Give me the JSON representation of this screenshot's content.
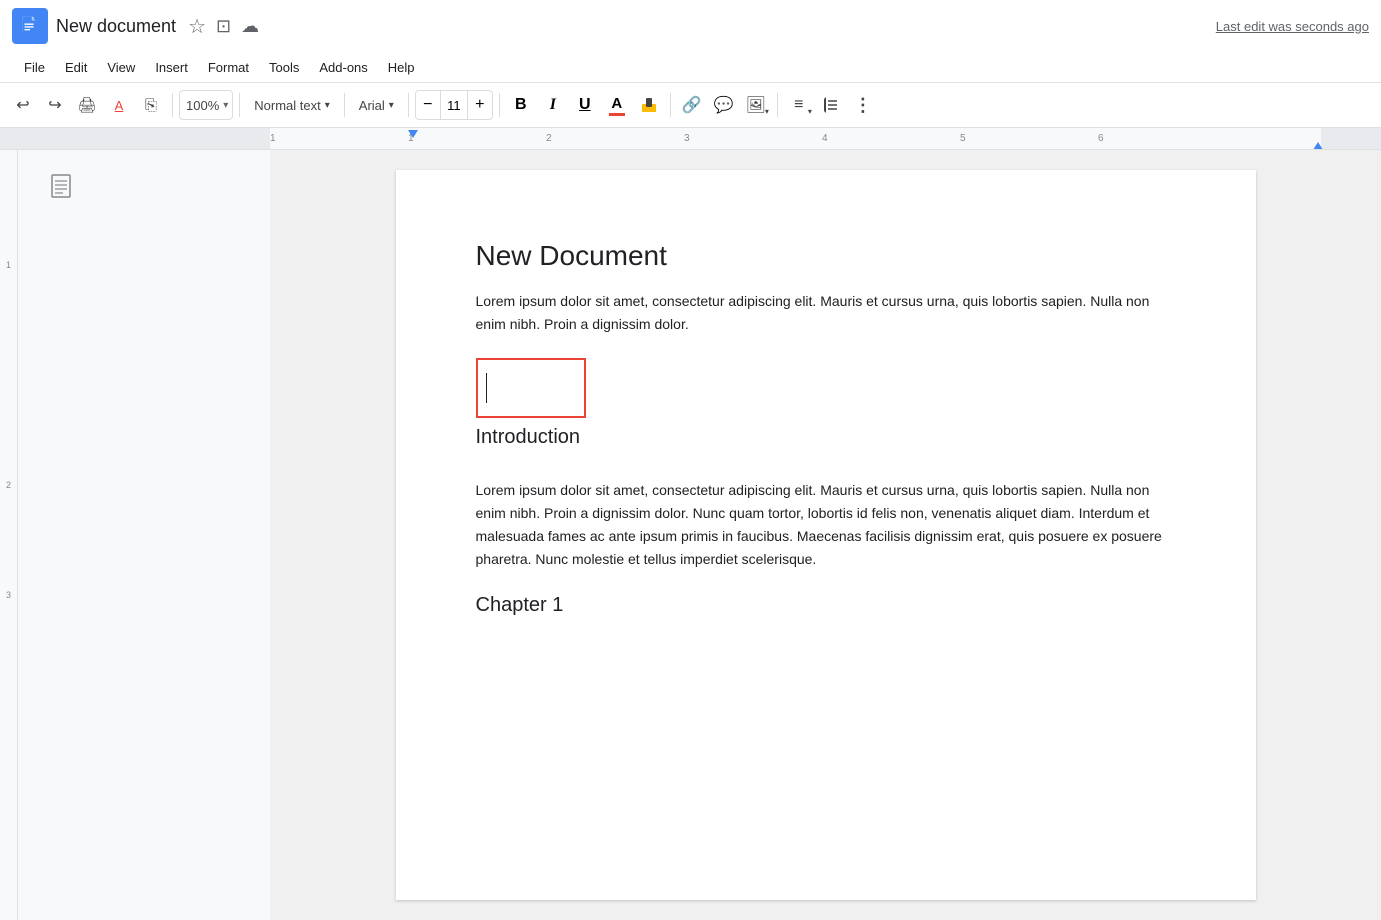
{
  "titleBar": {
    "appName": "New document",
    "starIcon": "☆",
    "driveIcon": "⊡",
    "cloudIcon": "☁",
    "lastEdit": "Last edit was seconds ago"
  },
  "menuBar": {
    "items": [
      "File",
      "Edit",
      "View",
      "Insert",
      "Format",
      "Tools",
      "Add-ons",
      "Help"
    ]
  },
  "toolbar": {
    "undo": "↩",
    "redo": "↪",
    "print": "🖨",
    "paintFormat": "🖌",
    "copyFormat": "⎘",
    "zoom": "100%",
    "zoomDropdown": "▾",
    "styleDropdown": "Normal text",
    "styleArrow": "▾",
    "fontDropdown": "Arial",
    "fontArrow": "▾",
    "fontSizeMinus": "−",
    "fontSize": "11",
    "fontSizePlus": "+",
    "bold": "B",
    "italic": "I",
    "underline": "U",
    "textColorLabel": "A",
    "highlightIcon": "🖍",
    "linkIcon": "🔗",
    "commentIcon": "💬",
    "imageIcon": "🖼",
    "alignIcon": "≡",
    "lineSpaceIcon": "↕",
    "moreIcon": "⋮"
  },
  "document": {
    "title": "New Document",
    "bodyText1": "Lorem ipsum dolor sit amet, consectetur adipiscing elit. Mauris et cursus urna, quis lobortis sapien. Nulla non enim nibh. Proin a dignissim dolor.",
    "introHeading": "Introduction",
    "bodyText2": "Lorem ipsum dolor sit amet, consectetur adipiscing elit. Mauris et cursus urna, quis lobortis sapien. Nulla non enim nibh. Proin a dignissim dolor. Nunc quam tortor, lobortis id felis non, venenatis aliquet diam. Interdum et malesuada fames ac ante ipsum primis in faucibus. Maecenas facilisis dignissim erat, quis posuere ex posuere pharetra. Nunc molestie et tellus imperdiet scelerisque.",
    "chapterHeading": "Chapter 1"
  },
  "ruler": {
    "marks": [
      "1",
      "1",
      "2",
      "3",
      "4",
      "5",
      "6"
    ]
  }
}
